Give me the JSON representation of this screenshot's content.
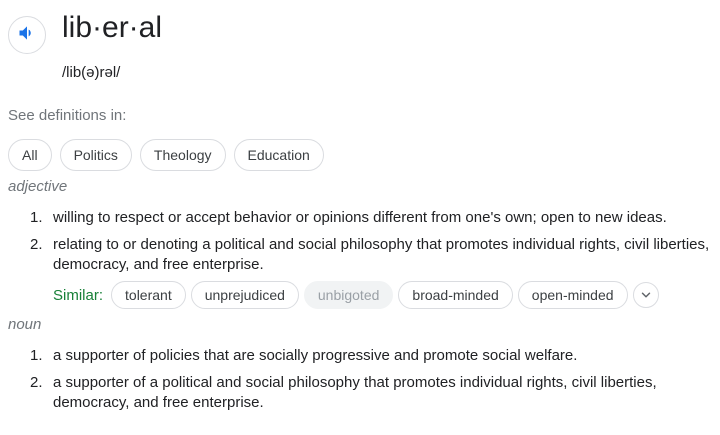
{
  "headword": "lib·er·al",
  "pronunciation": "/lib(ə)rəl/",
  "see_definitions": {
    "label": "See definitions in:",
    "chips": [
      "All",
      "Politics",
      "Theology",
      "Education"
    ]
  },
  "adjective": {
    "label": "adjective",
    "definitions": [
      {
        "num": "1.",
        "text": "willing to respect or accept behavior or opinions different from one's own; open to new ideas."
      },
      {
        "num": "2.",
        "text": "relating to or denoting a political and social philosophy that promotes individual rights, civil liberties, democracy, and free enterprise."
      }
    ],
    "similar": {
      "label": "Similar:",
      "words": [
        "tolerant",
        "unprejudiced",
        "unbigoted",
        "broad-minded",
        "open-minded"
      ]
    }
  },
  "noun": {
    "label": "noun",
    "definitions": [
      {
        "num": "1.",
        "text": "a supporter of policies that are socially progressive and promote social welfare."
      },
      {
        "num": "2.",
        "text": "a supporter of a political and social philosophy that promotes individual rights, civil liberties, democracy, and free enterprise."
      }
    ]
  },
  "icons": {
    "speaker": "speaker-icon",
    "expand": "chevron-down-icon"
  },
  "colors": {
    "accent_blue": "#1a73e8",
    "similar_green": "#188038",
    "muted": "#70757a"
  }
}
